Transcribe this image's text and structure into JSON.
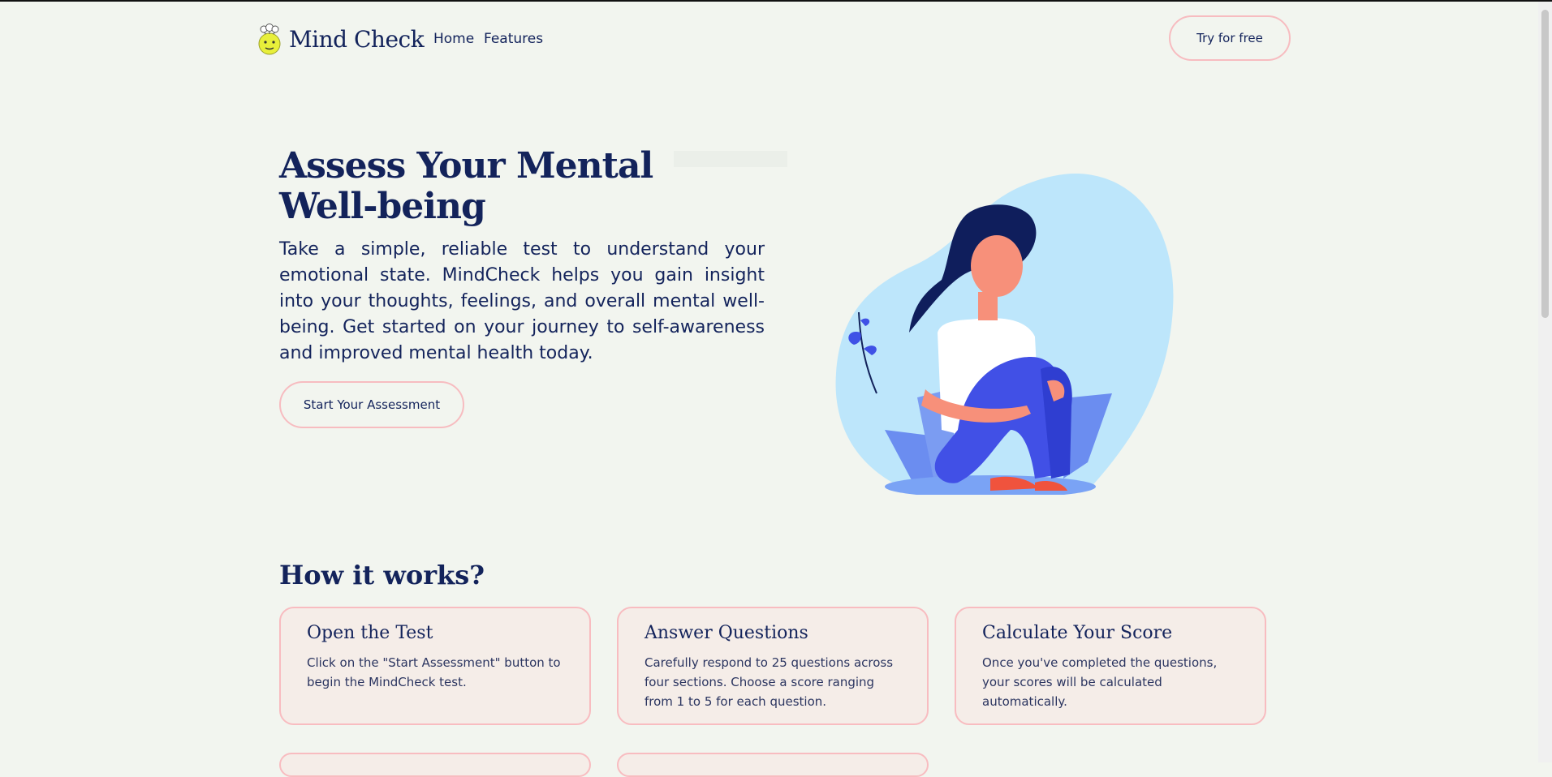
{
  "nav": {
    "brand": "Mind Check",
    "links": [
      {
        "label": "Home"
      },
      {
        "label": "Features"
      }
    ],
    "cta": "Try for free"
  },
  "hero": {
    "title": "Assess Your Mental Well-being",
    "description": "Take a simple, reliable test to understand your emotional state. MindCheck helps you gain insight into your thoughts, feelings, and overall mental well-being. Get started on your journey to self-awareness and improved mental health today.",
    "button": "Start Your Assessment"
  },
  "how_it_works": {
    "title": "How it works?",
    "cards": [
      {
        "title": "Open the Test",
        "text": "Click on the \"Start Assessment\" button to begin the MindCheck test."
      },
      {
        "title": "Answer Questions",
        "text": "Carefully respond to 25 questions across four sections. Choose a score ranging from 1 to 5 for each question."
      },
      {
        "title": "Calculate Your Score",
        "text": "Once you've completed the questions, your scores will be calculated automatically."
      }
    ]
  },
  "colors": {
    "background": "#f2f5ef",
    "navy": "#13235b",
    "pink_border": "#f7bcc0",
    "card_bg": "#f5ede8",
    "blob": "#bde6fb",
    "figure_blue": "#4150e6"
  },
  "icons": {
    "logo": "brain-face-icon"
  }
}
